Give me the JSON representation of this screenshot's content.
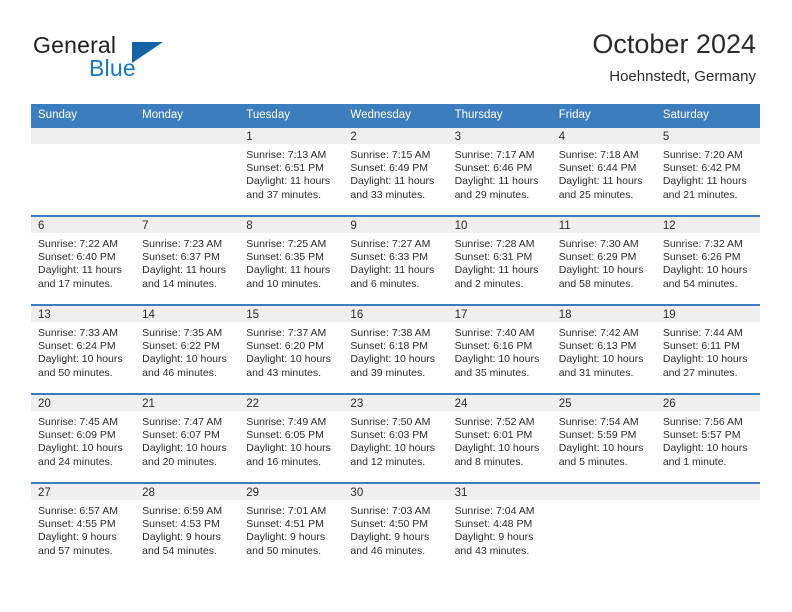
{
  "brand": {
    "name_top": "General",
    "name_bottom": "Blue",
    "logo_icon": "triangle-logo"
  },
  "header": {
    "title": "October 2024",
    "subtitle": "Hoehnstedt, Germany"
  },
  "colors": {
    "header_blue": "#3b7dbd",
    "brand_blue": "#1779c4",
    "row_shade": "#efefef",
    "text": "#2b2b2b"
  },
  "weekday_headers": [
    "Sunday",
    "Monday",
    "Tuesday",
    "Wednesday",
    "Thursday",
    "Friday",
    "Saturday"
  ],
  "weeks": [
    [
      {
        "day": "",
        "lines": []
      },
      {
        "day": "",
        "lines": []
      },
      {
        "day": "1",
        "lines": [
          "Sunrise: 7:13 AM",
          "Sunset: 6:51 PM",
          "Daylight: 11 hours",
          "and 37 minutes."
        ]
      },
      {
        "day": "2",
        "lines": [
          "Sunrise: 7:15 AM",
          "Sunset: 6:49 PM",
          "Daylight: 11 hours",
          "and 33 minutes."
        ]
      },
      {
        "day": "3",
        "lines": [
          "Sunrise: 7:17 AM",
          "Sunset: 6:46 PM",
          "Daylight: 11 hours",
          "and 29 minutes."
        ]
      },
      {
        "day": "4",
        "lines": [
          "Sunrise: 7:18 AM",
          "Sunset: 6:44 PM",
          "Daylight: 11 hours",
          "and 25 minutes."
        ]
      },
      {
        "day": "5",
        "lines": [
          "Sunrise: 7:20 AM",
          "Sunset: 6:42 PM",
          "Daylight: 11 hours",
          "and 21 minutes."
        ]
      }
    ],
    [
      {
        "day": "6",
        "lines": [
          "Sunrise: 7:22 AM",
          "Sunset: 6:40 PM",
          "Daylight: 11 hours",
          "and 17 minutes."
        ]
      },
      {
        "day": "7",
        "lines": [
          "Sunrise: 7:23 AM",
          "Sunset: 6:37 PM",
          "Daylight: 11 hours",
          "and 14 minutes."
        ]
      },
      {
        "day": "8",
        "lines": [
          "Sunrise: 7:25 AM",
          "Sunset: 6:35 PM",
          "Daylight: 11 hours",
          "and 10 minutes."
        ]
      },
      {
        "day": "9",
        "lines": [
          "Sunrise: 7:27 AM",
          "Sunset: 6:33 PM",
          "Daylight: 11 hours",
          "and 6 minutes."
        ]
      },
      {
        "day": "10",
        "lines": [
          "Sunrise: 7:28 AM",
          "Sunset: 6:31 PM",
          "Daylight: 11 hours",
          "and 2 minutes."
        ]
      },
      {
        "day": "11",
        "lines": [
          "Sunrise: 7:30 AM",
          "Sunset: 6:29 PM",
          "Daylight: 10 hours",
          "and 58 minutes."
        ]
      },
      {
        "day": "12",
        "lines": [
          "Sunrise: 7:32 AM",
          "Sunset: 6:26 PM",
          "Daylight: 10 hours",
          "and 54 minutes."
        ]
      }
    ],
    [
      {
        "day": "13",
        "lines": [
          "Sunrise: 7:33 AM",
          "Sunset: 6:24 PM",
          "Daylight: 10 hours",
          "and 50 minutes."
        ]
      },
      {
        "day": "14",
        "lines": [
          "Sunrise: 7:35 AM",
          "Sunset: 6:22 PM",
          "Daylight: 10 hours",
          "and 46 minutes."
        ]
      },
      {
        "day": "15",
        "lines": [
          "Sunrise: 7:37 AM",
          "Sunset: 6:20 PM",
          "Daylight: 10 hours",
          "and 43 minutes."
        ]
      },
      {
        "day": "16",
        "lines": [
          "Sunrise: 7:38 AM",
          "Sunset: 6:18 PM",
          "Daylight: 10 hours",
          "and 39 minutes."
        ]
      },
      {
        "day": "17",
        "lines": [
          "Sunrise: 7:40 AM",
          "Sunset: 6:16 PM",
          "Daylight: 10 hours",
          "and 35 minutes."
        ]
      },
      {
        "day": "18",
        "lines": [
          "Sunrise: 7:42 AM",
          "Sunset: 6:13 PM",
          "Daylight: 10 hours",
          "and 31 minutes."
        ]
      },
      {
        "day": "19",
        "lines": [
          "Sunrise: 7:44 AM",
          "Sunset: 6:11 PM",
          "Daylight: 10 hours",
          "and 27 minutes."
        ]
      }
    ],
    [
      {
        "day": "20",
        "lines": [
          "Sunrise: 7:45 AM",
          "Sunset: 6:09 PM",
          "Daylight: 10 hours",
          "and 24 minutes."
        ]
      },
      {
        "day": "21",
        "lines": [
          "Sunrise: 7:47 AM",
          "Sunset: 6:07 PM",
          "Daylight: 10 hours",
          "and 20 minutes."
        ]
      },
      {
        "day": "22",
        "lines": [
          "Sunrise: 7:49 AM",
          "Sunset: 6:05 PM",
          "Daylight: 10 hours",
          "and 16 minutes."
        ]
      },
      {
        "day": "23",
        "lines": [
          "Sunrise: 7:50 AM",
          "Sunset: 6:03 PM",
          "Daylight: 10 hours",
          "and 12 minutes."
        ]
      },
      {
        "day": "24",
        "lines": [
          "Sunrise: 7:52 AM",
          "Sunset: 6:01 PM",
          "Daylight: 10 hours",
          "and 8 minutes."
        ]
      },
      {
        "day": "25",
        "lines": [
          "Sunrise: 7:54 AM",
          "Sunset: 5:59 PM",
          "Daylight: 10 hours",
          "and 5 minutes."
        ]
      },
      {
        "day": "26",
        "lines": [
          "Sunrise: 7:56 AM",
          "Sunset: 5:57 PM",
          "Daylight: 10 hours",
          "and 1 minute."
        ]
      }
    ],
    [
      {
        "day": "27",
        "lines": [
          "Sunrise: 6:57 AM",
          "Sunset: 4:55 PM",
          "Daylight: 9 hours",
          "and 57 minutes."
        ]
      },
      {
        "day": "28",
        "lines": [
          "Sunrise: 6:59 AM",
          "Sunset: 4:53 PM",
          "Daylight: 9 hours",
          "and 54 minutes."
        ]
      },
      {
        "day": "29",
        "lines": [
          "Sunrise: 7:01 AM",
          "Sunset: 4:51 PM",
          "Daylight: 9 hours",
          "and 50 minutes."
        ]
      },
      {
        "day": "30",
        "lines": [
          "Sunrise: 7:03 AM",
          "Sunset: 4:50 PM",
          "Daylight: 9 hours",
          "and 46 minutes."
        ]
      },
      {
        "day": "31",
        "lines": [
          "Sunrise: 7:04 AM",
          "Sunset: 4:48 PM",
          "Daylight: 9 hours",
          "and 43 minutes."
        ]
      },
      {
        "day": "",
        "lines": []
      },
      {
        "day": "",
        "lines": []
      }
    ]
  ]
}
